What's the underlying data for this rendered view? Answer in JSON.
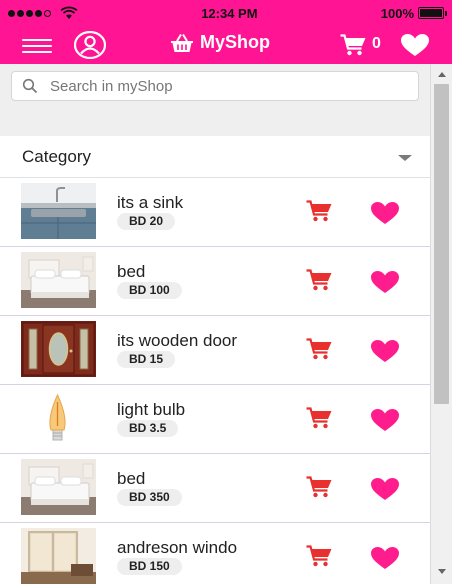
{
  "status_bar": {
    "time": "12:34 PM",
    "battery_label": "100%",
    "battery_level": 1.0,
    "signal_bars_filled": 4,
    "signal_bars_total": 5
  },
  "nav": {
    "brand": "MyShop",
    "cart_count": "0",
    "icons": [
      "menu-icon",
      "user-icon",
      "basket-icon",
      "cart-icon",
      "heart-icon"
    ]
  },
  "search": {
    "placeholder": "Search in myShop"
  },
  "category": {
    "label": "Category"
  },
  "products": [
    {
      "name": "its a sink",
      "price": "BD 20",
      "image": "sink"
    },
    {
      "name": "bed",
      "price": "BD 100",
      "image": "bed"
    },
    {
      "name": "its wooden door",
      "price": "BD 15",
      "image": "door"
    },
    {
      "name": "light bulb",
      "price": "BD 3.5",
      "image": "bulb"
    },
    {
      "name": "bed",
      "price": "BD 350",
      "image": "bed"
    },
    {
      "name": "andreson windo",
      "price": "BD 150",
      "image": "window"
    }
  ],
  "colors": {
    "brand_pink": "#ff1493",
    "cart_red": "#e8302e",
    "heart_pink": "#ff1d8e"
  }
}
